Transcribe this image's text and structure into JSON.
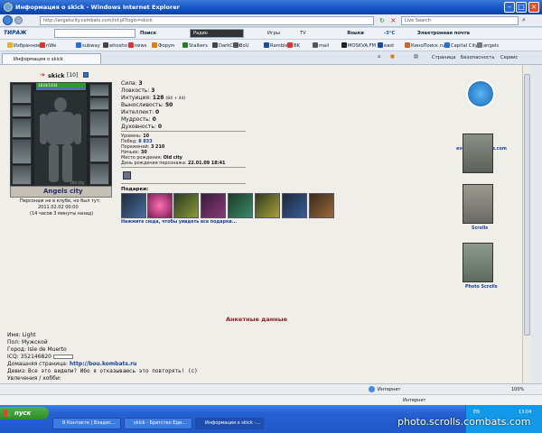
{
  "window": {
    "title": "Информация о skick - Windows Internet Explorer"
  },
  "address": {
    "url": "http://angelscity.combats.com/inf.pl?login=skick",
    "search_placeholder": "Live Search"
  },
  "toolbar1": {
    "brand": "ТИРАЖ",
    "search_button": "Поиск",
    "radio": "Радио",
    "games": "Игры",
    "tv": "TV",
    "languages": "Языки",
    "weather": "-3°C",
    "mail": "Электронная почта"
  },
  "toolbar2": {
    "items": [
      "Избранное",
      "nWe",
      "subway",
      "whosho",
      "news",
      "Форум",
      "Stalkers",
      "DarkClan",
      "BoU",
      "Rambler",
      "BK",
      "mail",
      "MOSKVA.FM",
      "east",
      "КиноПоиск.ru",
      "Capital City",
      "angels"
    ]
  },
  "tabbar": {
    "tab_title": "Информация о skick",
    "menu_page": "Страница",
    "menu_security": "Безопасность",
    "menu_service": "Сервис"
  },
  "character": {
    "name": "skick",
    "level": "[10]",
    "hp": "1834/1834",
    "city": "Angels city",
    "status_lines": [
      "Персонаж не в клубе, но был тут:",
      "2011.02.02 00:00",
      "(14 часов 3 минуты назад)"
    ],
    "arena_label": "Old city",
    "stats": [
      {
        "label": "Сила:",
        "value": "3"
      },
      {
        "label": "Ловкость:",
        "value": "3"
      },
      {
        "label": "Интуиция:",
        "value": "128",
        "extra": "(84 + 44)"
      },
      {
        "label": "Выносливость:",
        "value": "50"
      },
      {
        "label": "Интеллект:",
        "value": "0"
      },
      {
        "label": "Мудрость:",
        "value": "0"
      },
      {
        "label": "Духовность:",
        "value": "0"
      }
    ],
    "details": [
      {
        "label": "Уровень:",
        "value": "10"
      },
      {
        "label": "Побед:",
        "value": "8 833"
      },
      {
        "label": "Поражений:",
        "value": "3 210"
      },
      {
        "label": "Ничьих:",
        "value": "30"
      },
      {
        "label": "Место рождения:",
        "value": "Old city"
      },
      {
        "label": "День рождения персонажа:",
        "value": "22.01.09 18:41"
      }
    ],
    "gifts_label": "Подарки:",
    "gifts_link": "Нажмите сюда, чтобы увидеть все подарки..."
  },
  "sidebar_links": [
    {
      "label": "events.combats.com"
    },
    {
      "label": "Scrolls"
    },
    {
      "label": "Photo Scrolls"
    }
  ],
  "anketa": {
    "heading": "Анкетные данные",
    "name_label": "Имя:",
    "name_value": "Light",
    "gender_label": "Пол:",
    "gender_value": "Мужской",
    "city_label": "Город:",
    "city_value": "Isle de Muerto",
    "icq_label": "ICQ:",
    "icq_value": "352146820",
    "homepage_label": "Домашняя страница:",
    "homepage_value": "http://bou.kombats.ru",
    "motto_label": "Девиз:",
    "motto_value": "Все это видели? Ибо я отказываюсь это повторять! (с)",
    "hobby_label": "Увлечения / хобби:"
  },
  "statusbar": {
    "zone": "Интернет",
    "zoom": "100%",
    "zone2": "Интернет"
  },
  "taskbar": {
    "start": "пуск",
    "tasks": [
      "В Контакте | Владис...",
      "skick - Братство Еди...",
      "Информация о skick -..."
    ],
    "lang": "EN",
    "time": "13:04"
  },
  "watermark": "photo.scrolls.combats.com"
}
